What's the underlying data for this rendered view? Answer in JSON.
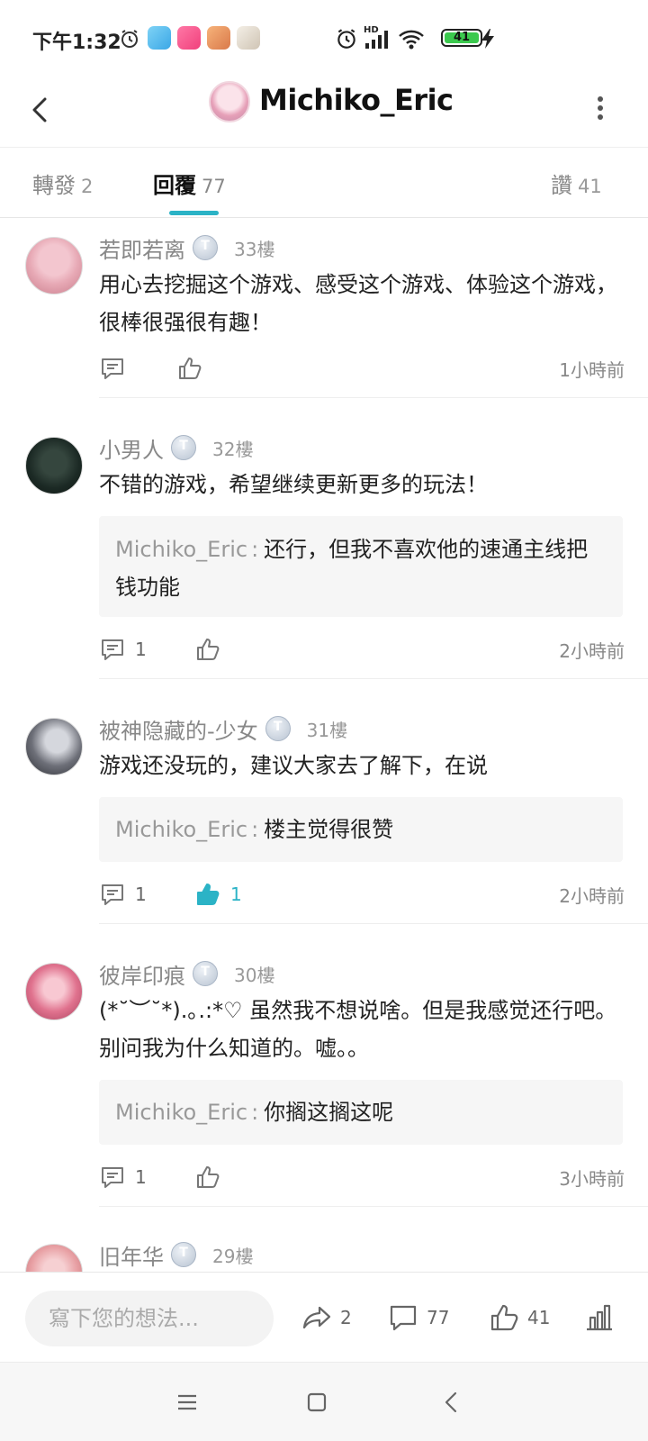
{
  "status_bar": {
    "time": "下午1:32",
    "battery": "41",
    "network": "HD",
    "icons": [
      "alarm-icon",
      "app-icon-blue",
      "app-icon-pink",
      "app-icon-orange",
      "app-icon-white",
      "alarm-icon",
      "signal-icon",
      "wifi-icon",
      "battery-icon",
      "charging-icon"
    ]
  },
  "header": {
    "title": "Michiko_Eric",
    "back_icon": "chevron-left-icon",
    "more_icon": "more-vertical-icon"
  },
  "tabs": [
    {
      "label": "轉發",
      "count": "2",
      "active": false
    },
    {
      "label": "回覆",
      "count": "77",
      "active": true
    },
    {
      "label": "讚",
      "count": "41",
      "active": false
    }
  ],
  "comments": [
    {
      "author": "若即若离",
      "level": "T",
      "floor": "33樓",
      "text": "用心去挖掘这个游戏、感受这个游戏、体验这个游戏，很棒很强很有趣！",
      "reply_count": "",
      "like_count": "",
      "liked": false,
      "time": "1小時前",
      "avatar_color": "#e7a9b5"
    },
    {
      "author": "小男人",
      "level": "T",
      "floor": "32樓",
      "text": "不错的游戏，希望继续更新更多的玩法！",
      "reply": {
        "author": "Michiko_Eric",
        "sep": ":",
        "text": "还行，但我不喜欢他的速通主线把钱功能"
      },
      "reply_count": "1",
      "like_count": "",
      "liked": false,
      "time": "2小時前",
      "avatar_color": "#1c2a25"
    },
    {
      "author": "被神隐藏的-少女",
      "level": "T",
      "floor": "31樓",
      "text": "游戏还没玩的，建议大家去了解下，在说",
      "reply": {
        "author": "Michiko_Eric",
        "sep": ":",
        "text": "楼主觉得很赞"
      },
      "reply_count": "1",
      "like_count": "1",
      "liked": true,
      "time": "2小時前",
      "avatar_color": "#6d6f78"
    },
    {
      "author": "彼岸印痕",
      "level": "T",
      "floor": "30樓",
      "text": "(*˘︶˘*).｡.:*♡ 虽然我不想说啥。但是我感觉还行吧。别问我为什么知道的。嘘。。",
      "reply": {
        "author": "Michiko_Eric",
        "sep": ":",
        "text": "你搁这搁这呢"
      },
      "reply_count": "1",
      "like_count": "",
      "liked": false,
      "time": "3小時前",
      "avatar_color": "#e0728e"
    },
    {
      "author": "旧年华",
      "level": "T",
      "floor": "29樓",
      "text": "",
      "avatar_color": "#e8a0a4"
    }
  ],
  "bottom_bar": {
    "placeholder": "寫下您的想法...",
    "share_count": "2",
    "comment_count": "77",
    "like_count": "41",
    "stats_icon": "bar-chart-icon"
  },
  "nav_bar": {
    "icons": [
      "menu-icon",
      "home-square-icon",
      "back-icon"
    ]
  },
  "colors": {
    "accent": "#2bb3c6",
    "text_primary": "#222222",
    "text_secondary": "#888888",
    "reply_bg": "#f6f6f6"
  }
}
